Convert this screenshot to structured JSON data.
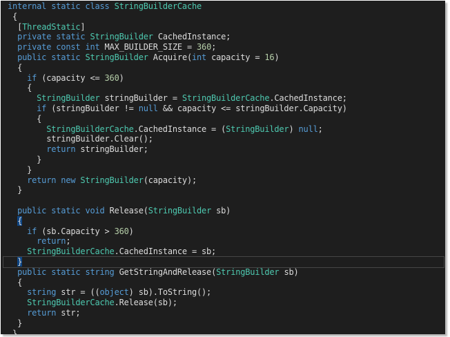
{
  "colors": {
    "background": "#1e1e1e",
    "keyword": "#569cd6",
    "type": "#4ec9b0",
    "plain": "#dcdcdc",
    "number": "#b5cea8",
    "brace_highlight": "#0e4583",
    "current_line_border": "#464646"
  },
  "code": {
    "lines": [
      {
        "indent": "",
        "tokens": [
          [
            "kw",
            "internal"
          ],
          [
            "id",
            " "
          ],
          [
            "kw",
            "static"
          ],
          [
            "id",
            " "
          ],
          [
            "kw",
            "class"
          ],
          [
            "id",
            " "
          ],
          [
            "ty",
            "StringBuilderCache"
          ]
        ]
      },
      {
        "indent": " ",
        "tokens": [
          [
            "id",
            "{"
          ]
        ]
      },
      {
        "indent": "  ",
        "tokens": [
          [
            "id",
            "["
          ],
          [
            "ty",
            "ThreadStatic"
          ],
          [
            "id",
            "]"
          ]
        ]
      },
      {
        "indent": "  ",
        "tokens": [
          [
            "kw",
            "private"
          ],
          [
            "id",
            " "
          ],
          [
            "kw",
            "static"
          ],
          [
            "id",
            " "
          ],
          [
            "ty",
            "StringBuilder"
          ],
          [
            "id",
            " CachedInstance;"
          ]
        ]
      },
      {
        "indent": "  ",
        "tokens": [
          [
            "kw",
            "private"
          ],
          [
            "id",
            " "
          ],
          [
            "kw",
            "const"
          ],
          [
            "id",
            " "
          ],
          [
            "kw",
            "int"
          ],
          [
            "id",
            " MAX_BUILDER_SIZE = "
          ],
          [
            "num",
            "360"
          ],
          [
            "id",
            ";"
          ]
        ]
      },
      {
        "indent": "  ",
        "tokens": [
          [
            "kw",
            "public"
          ],
          [
            "id",
            " "
          ],
          [
            "kw",
            "static"
          ],
          [
            "id",
            " "
          ],
          [
            "ty",
            "StringBuilder"
          ],
          [
            "id",
            " Acquire("
          ],
          [
            "kw",
            "int"
          ],
          [
            "id",
            " capacity = "
          ],
          [
            "num",
            "16"
          ],
          [
            "id",
            ")"
          ]
        ]
      },
      {
        "indent": "  ",
        "tokens": [
          [
            "id",
            "{"
          ]
        ]
      },
      {
        "indent": "    ",
        "tokens": [
          [
            "kw",
            "if"
          ],
          [
            "id",
            " (capacity <= "
          ],
          [
            "num",
            "360"
          ],
          [
            "id",
            ")"
          ]
        ]
      },
      {
        "indent": "    ",
        "tokens": [
          [
            "id",
            "{"
          ]
        ]
      },
      {
        "indent": "      ",
        "tokens": [
          [
            "ty",
            "StringBuilder"
          ],
          [
            "id",
            " stringBuilder = "
          ],
          [
            "ty",
            "StringBuilderCache"
          ],
          [
            "id",
            ".CachedInstance;"
          ]
        ]
      },
      {
        "indent": "      ",
        "tokens": [
          [
            "kw",
            "if"
          ],
          [
            "id",
            " (stringBuilder != "
          ],
          [
            "kw",
            "null"
          ],
          [
            "id",
            " && capacity <= stringBuilder.Capacity)"
          ]
        ]
      },
      {
        "indent": "      ",
        "tokens": [
          [
            "id",
            "{"
          ]
        ]
      },
      {
        "indent": "        ",
        "tokens": [
          [
            "ty",
            "StringBuilderCache"
          ],
          [
            "id",
            ".CachedInstance = ("
          ],
          [
            "ty",
            "StringBuilder"
          ],
          [
            "id",
            ") "
          ],
          [
            "kw",
            "null"
          ],
          [
            "id",
            ";"
          ]
        ]
      },
      {
        "indent": "        ",
        "tokens": [
          [
            "id",
            "stringBuilder.Clear();"
          ]
        ]
      },
      {
        "indent": "        ",
        "tokens": [
          [
            "kw",
            "return"
          ],
          [
            "id",
            " stringBuilder;"
          ]
        ]
      },
      {
        "indent": "      ",
        "tokens": [
          [
            "id",
            "}"
          ]
        ]
      },
      {
        "indent": "    ",
        "tokens": [
          [
            "id",
            "}"
          ]
        ]
      },
      {
        "indent": "    ",
        "tokens": [
          [
            "kw",
            "return"
          ],
          [
            "id",
            " "
          ],
          [
            "kw",
            "new"
          ],
          [
            "id",
            " "
          ],
          [
            "ty",
            "StringBuilder"
          ],
          [
            "id",
            "(capacity);"
          ]
        ]
      },
      {
        "indent": "  ",
        "tokens": [
          [
            "id",
            "}"
          ]
        ]
      },
      {
        "indent": "",
        "tokens": []
      },
      {
        "indent": "  ",
        "tokens": [
          [
            "kw",
            "public"
          ],
          [
            "id",
            " "
          ],
          [
            "kw",
            "static"
          ],
          [
            "id",
            " "
          ],
          [
            "kw",
            "void"
          ],
          [
            "id",
            " Release("
          ],
          [
            "ty",
            "StringBuilder"
          ],
          [
            "id",
            " sb)"
          ]
        ]
      },
      {
        "indent": "  ",
        "tokens": [
          [
            "hl",
            "{"
          ]
        ]
      },
      {
        "indent": "    ",
        "tokens": [
          [
            "kw",
            "if"
          ],
          [
            "id",
            " (sb.Capacity > "
          ],
          [
            "num",
            "360"
          ],
          [
            "id",
            ")"
          ]
        ]
      },
      {
        "indent": "      ",
        "tokens": [
          [
            "kw",
            "return"
          ],
          [
            "id",
            ";"
          ]
        ]
      },
      {
        "indent": "    ",
        "tokens": [
          [
            "ty",
            "StringBuilderCache"
          ],
          [
            "id",
            ".CachedInstance = sb;"
          ]
        ]
      },
      {
        "indent": "  ",
        "current": true,
        "tokens": [
          [
            "hl",
            "}"
          ]
        ]
      },
      {
        "indent": "  ",
        "tokens": [
          [
            "kw",
            "public"
          ],
          [
            "id",
            " "
          ],
          [
            "kw",
            "static"
          ],
          [
            "id",
            " "
          ],
          [
            "kw",
            "string"
          ],
          [
            "id",
            " GetStringAndRelease("
          ],
          [
            "ty",
            "StringBuilder"
          ],
          [
            "id",
            " sb)"
          ]
        ]
      },
      {
        "indent": "  ",
        "tokens": [
          [
            "id",
            "{"
          ]
        ]
      },
      {
        "indent": "    ",
        "tokens": [
          [
            "kw",
            "string"
          ],
          [
            "id",
            " str = (("
          ],
          [
            "kw",
            "object"
          ],
          [
            "id",
            ") sb).ToString();"
          ]
        ]
      },
      {
        "indent": "    ",
        "tokens": [
          [
            "ty",
            "StringBuilderCache"
          ],
          [
            "id",
            ".Release(sb);"
          ]
        ]
      },
      {
        "indent": "    ",
        "tokens": [
          [
            "kw",
            "return"
          ],
          [
            "id",
            " str;"
          ]
        ]
      },
      {
        "indent": "  ",
        "tokens": [
          [
            "id",
            "}"
          ]
        ]
      },
      {
        "indent": " ",
        "tokens": [
          [
            "id",
            "}"
          ]
        ]
      }
    ]
  }
}
